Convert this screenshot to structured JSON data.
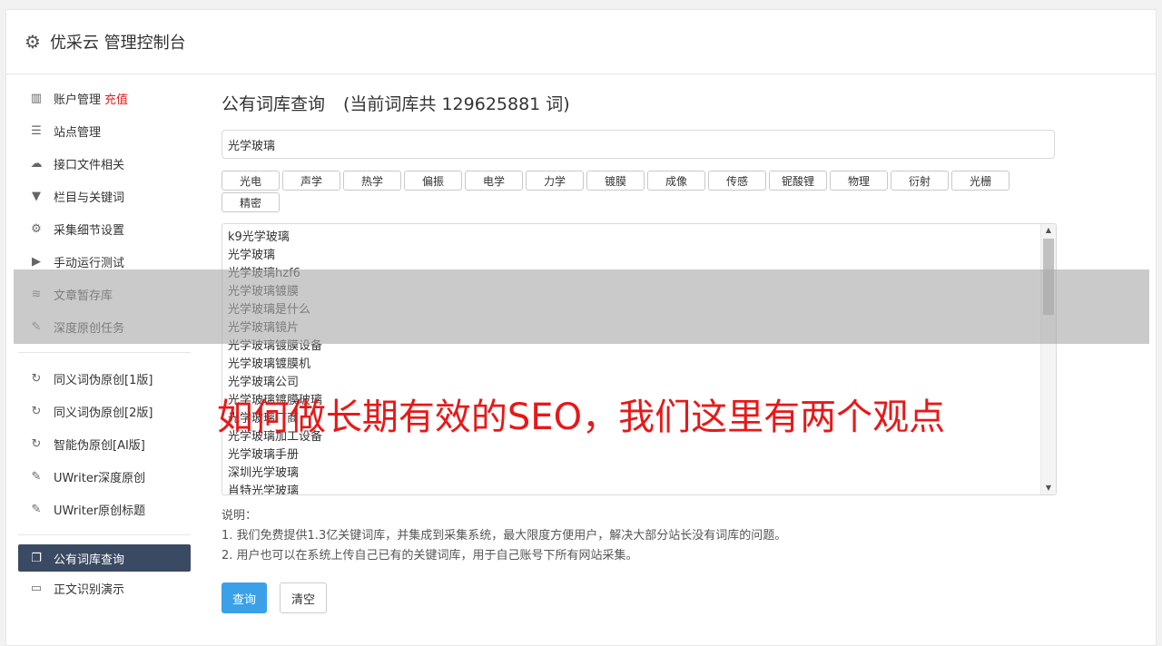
{
  "header": {
    "title": "优采云 管理控制台",
    "icon": "gear-icon"
  },
  "sidebar": {
    "items": [
      {
        "label": "账户管理",
        "highlight": "充值",
        "icon": "bar-chart-icon",
        "glyph": "▥"
      },
      {
        "label": "站点管理",
        "icon": "server-icon",
        "glyph": "☰"
      },
      {
        "label": "接口文件相关",
        "icon": "cloud-upload-icon",
        "glyph": "☁"
      },
      {
        "label": "栏目与关键词",
        "icon": "filter-icon",
        "glyph": "▼"
      },
      {
        "label": "采集细节设置",
        "icon": "cogs-icon",
        "glyph": "⚙"
      },
      {
        "label": "手动运行测试",
        "icon": "play-circle-icon",
        "glyph": "▶"
      },
      {
        "label": "文章暂存库",
        "icon": "database-icon",
        "glyph": "≋"
      },
      {
        "label": "深度原创任务",
        "icon": "edit-icon",
        "glyph": "✎"
      }
    ],
    "items2": [
      {
        "label": "同义词伪原创[1版]",
        "icon": "refresh-icon",
        "glyph": "↻"
      },
      {
        "label": "同义词伪原创[2版]",
        "icon": "refresh-icon",
        "glyph": "↻"
      },
      {
        "label": "智能伪原创[AI版]",
        "icon": "refresh-icon",
        "glyph": "↻"
      },
      {
        "label": "UWriter深度原创",
        "icon": "edit-icon",
        "glyph": "✎"
      },
      {
        "label": "UWriter原创标题",
        "icon": "edit-icon",
        "glyph": "✎"
      }
    ],
    "items3": [
      {
        "label": "公有词库查询",
        "icon": "book-icon",
        "glyph": "❐"
      },
      {
        "label": "正文识别演示",
        "icon": "monitor-icon",
        "glyph": "▭"
      }
    ]
  },
  "main": {
    "title": "公有词库查询",
    "count_text": "(当前词库共 129625881 词)",
    "search_value": "光学玻璃",
    "tags": [
      "光电",
      "声学",
      "热学",
      "偏振",
      "电学",
      "力学",
      "镀膜",
      "成像",
      "传感",
      "铌酸锂",
      "物理",
      "衍射",
      "光栅",
      "精密"
    ],
    "results": [
      "k9光学玻璃",
      "光学玻璃",
      "光学玻璃hzf6",
      "光学玻璃镀膜",
      "光学玻璃是什么",
      "光学玻璃镜片",
      "光学玻璃镀膜设备",
      "光学玻璃镀膜机",
      "光学玻璃公司",
      "光学玻璃镀膜玻璃",
      "光学玻璃厂商",
      "光学玻璃加工设备",
      "光学玻璃手册",
      "深圳光学玻璃",
      "肖特光学玻璃"
    ],
    "notes_title": "说明：",
    "notes": [
      "1. 我们免费提供1.3亿关键词库，并集成到采集系统，最大限度方便用户，解决大部分站长没有词库的问题。",
      "2. 用户也可以在系统上传自己已有的关键词库，用于自己账号下所有网站采集。"
    ],
    "query_button": "查询",
    "clear_button": "清空"
  },
  "overlay": {
    "text": "如何做长期有效的SEO，我们这里有两个观点"
  },
  "colors": {
    "accent": "#3aa0e8",
    "sidebar_active": "#3b4a63",
    "overlay_text": "#e81818",
    "highlight": "#e02020"
  }
}
